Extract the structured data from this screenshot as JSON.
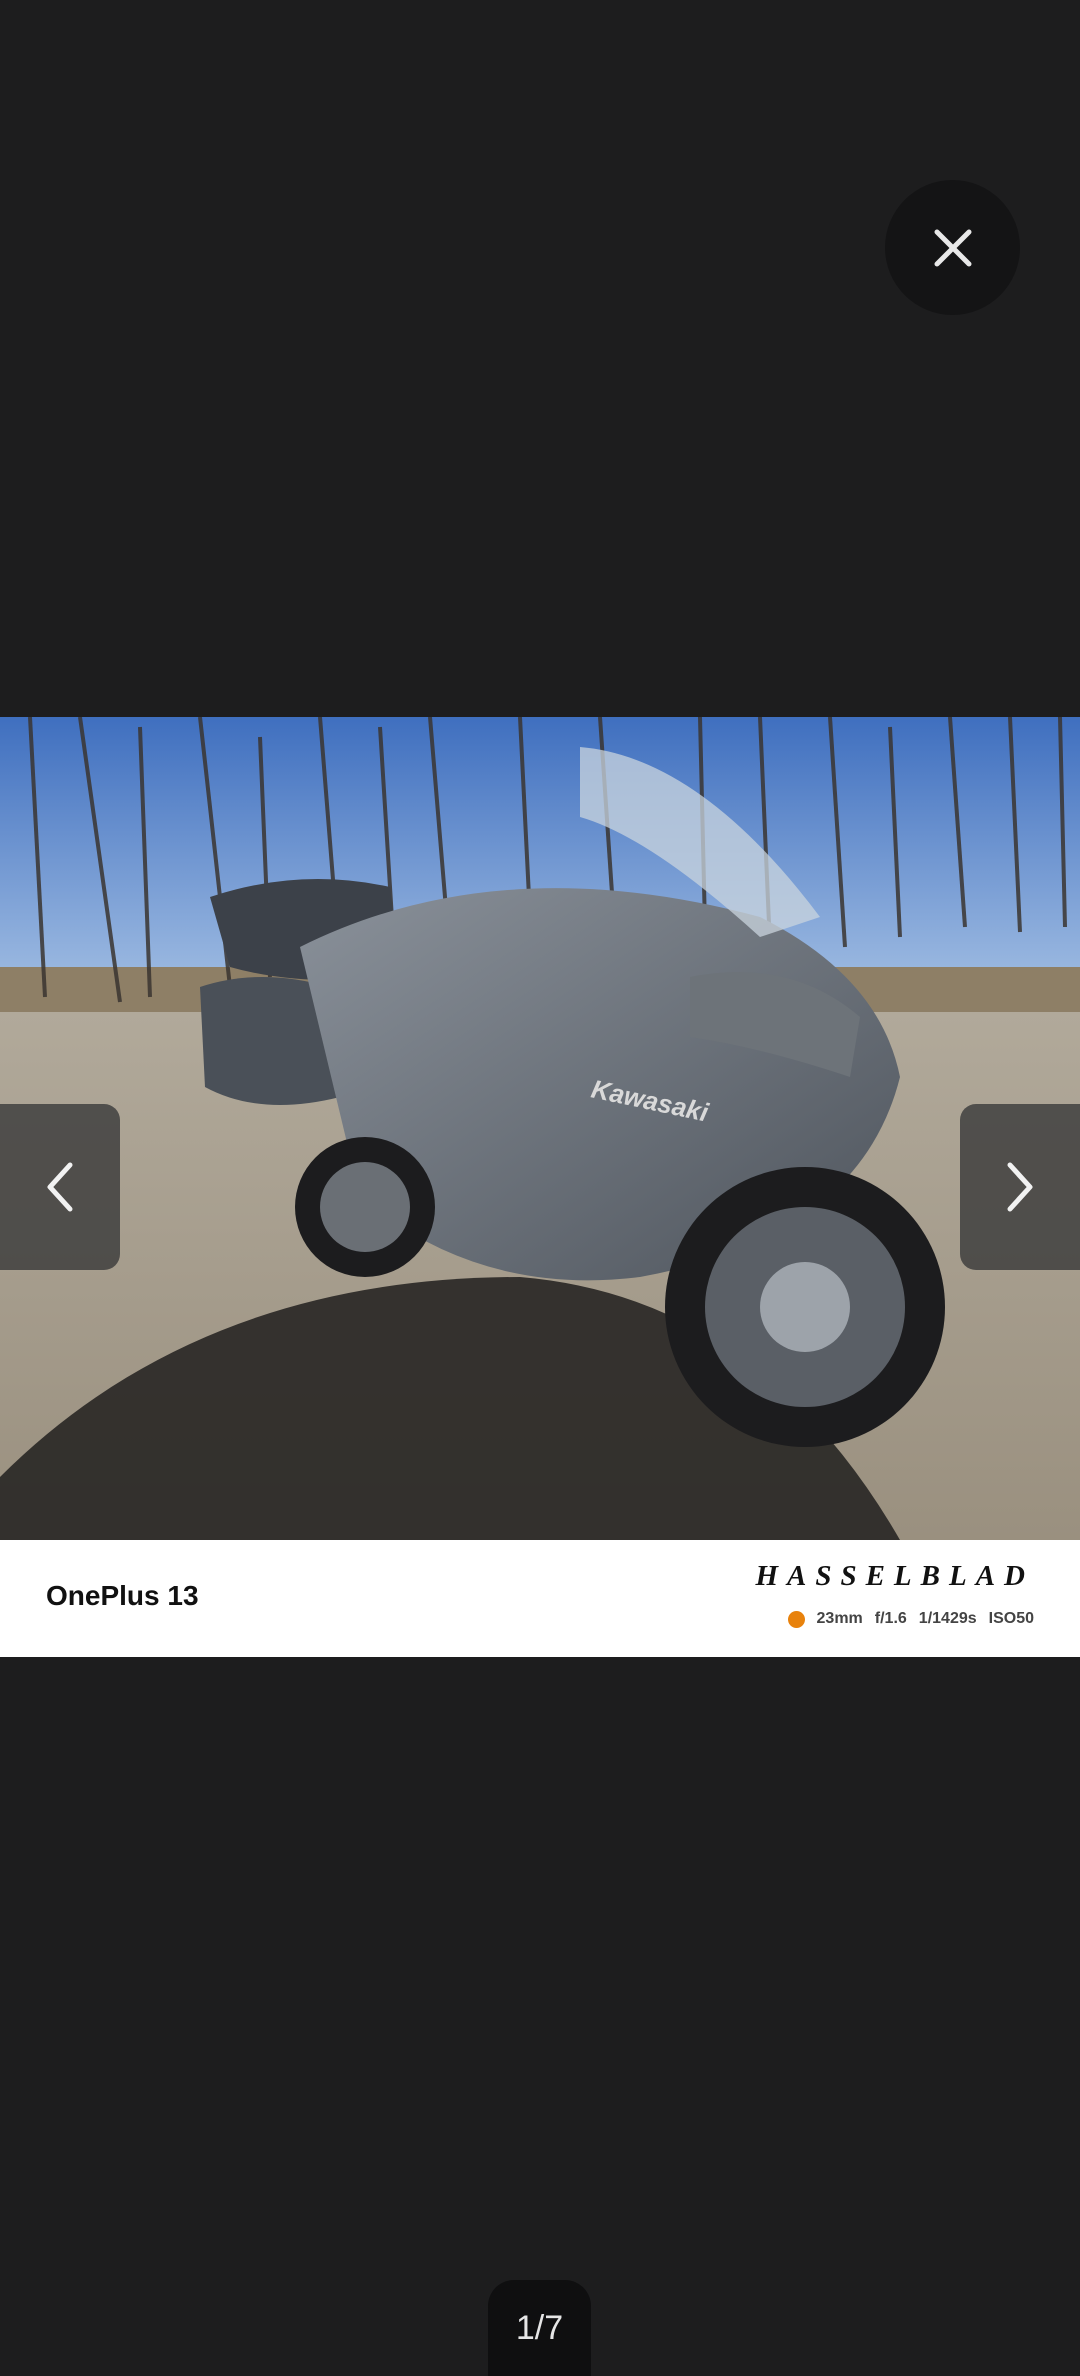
{
  "viewer": {
    "close_icon": "close-icon",
    "prev_icon": "chevron-left-icon",
    "next_icon": "chevron-right-icon",
    "counter": "1/7"
  },
  "photo": {
    "subject": "motorcycle",
    "fairing_text": "Kawasaki"
  },
  "watermark": {
    "device": "OnePlus 13",
    "brand": "HASSELBLAD",
    "accent_color": "#e8820c",
    "exif": [
      "23mm",
      "f/1.6",
      "1/1429s",
      "ISO50"
    ]
  }
}
